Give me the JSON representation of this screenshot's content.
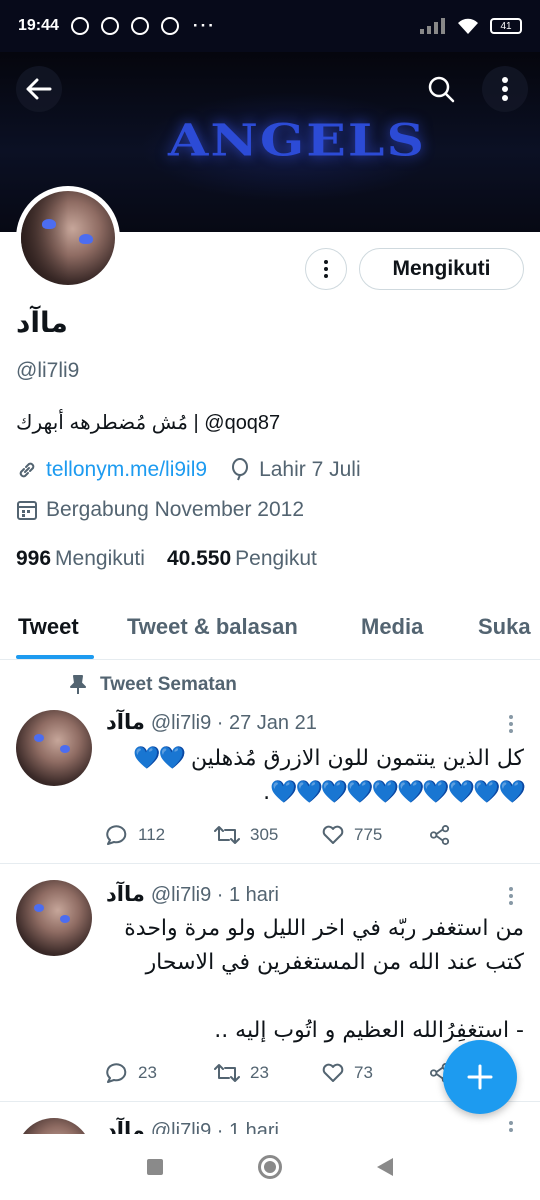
{
  "status_bar": {
    "time": "19:44",
    "more": "···",
    "battery": "41"
  },
  "banner": {
    "text": "ANGELS"
  },
  "profile": {
    "display_name": "ماآد",
    "handle": "@li7li9",
    "bio": "مُش مُضطرهه أبهرك | @qoq87",
    "website": "tellonym.me/li9il9",
    "birthday": "Lahir 7 Juli",
    "joined": "Bergabung November 2012",
    "following_count": "996",
    "following_label": "Mengikuti",
    "followers_count": "40.550",
    "followers_label": "Pengikut",
    "follow_button_label": "Mengikuti"
  },
  "tabs": [
    {
      "label": "Tweet",
      "active": true
    },
    {
      "label": "Tweet & balasan",
      "active": false
    },
    {
      "label": "Media",
      "active": false
    },
    {
      "label": "Suka",
      "active": false
    }
  ],
  "pinned_label": "Tweet Sematan",
  "tweets": [
    {
      "name": "ماآد",
      "meta": "@li7li9 · 27 Jan 21",
      "line1": "كل الذين ينتمون للون الازرق مُذهلين",
      "hearts1": "💙💙",
      "hearts2": "💙💙💙💙💙💙💙💙💙💙",
      "line2_end": ".",
      "replies": "112",
      "retweets": "305",
      "likes": "775"
    },
    {
      "name": "ماآد",
      "meta": "@li7li9 · 1 hari",
      "lines": [
        "من استغفر ربّه في اخر الليل ولو مرة واحدة",
        "كتب عند الله من المستغفرين في الاسحار",
        "",
        "- استغفِرُالله العظيم و اتُوب إليه .."
      ],
      "replies": "23",
      "retweets": "23",
      "likes": "73"
    },
    {
      "name": "ماآد",
      "meta": "@li7li9 · 1 hari"
    }
  ],
  "colors": {
    "accent": "#1d9bf0",
    "text": "#0f1419",
    "muted": "#536471",
    "banner_text": "#2c4bd6"
  }
}
